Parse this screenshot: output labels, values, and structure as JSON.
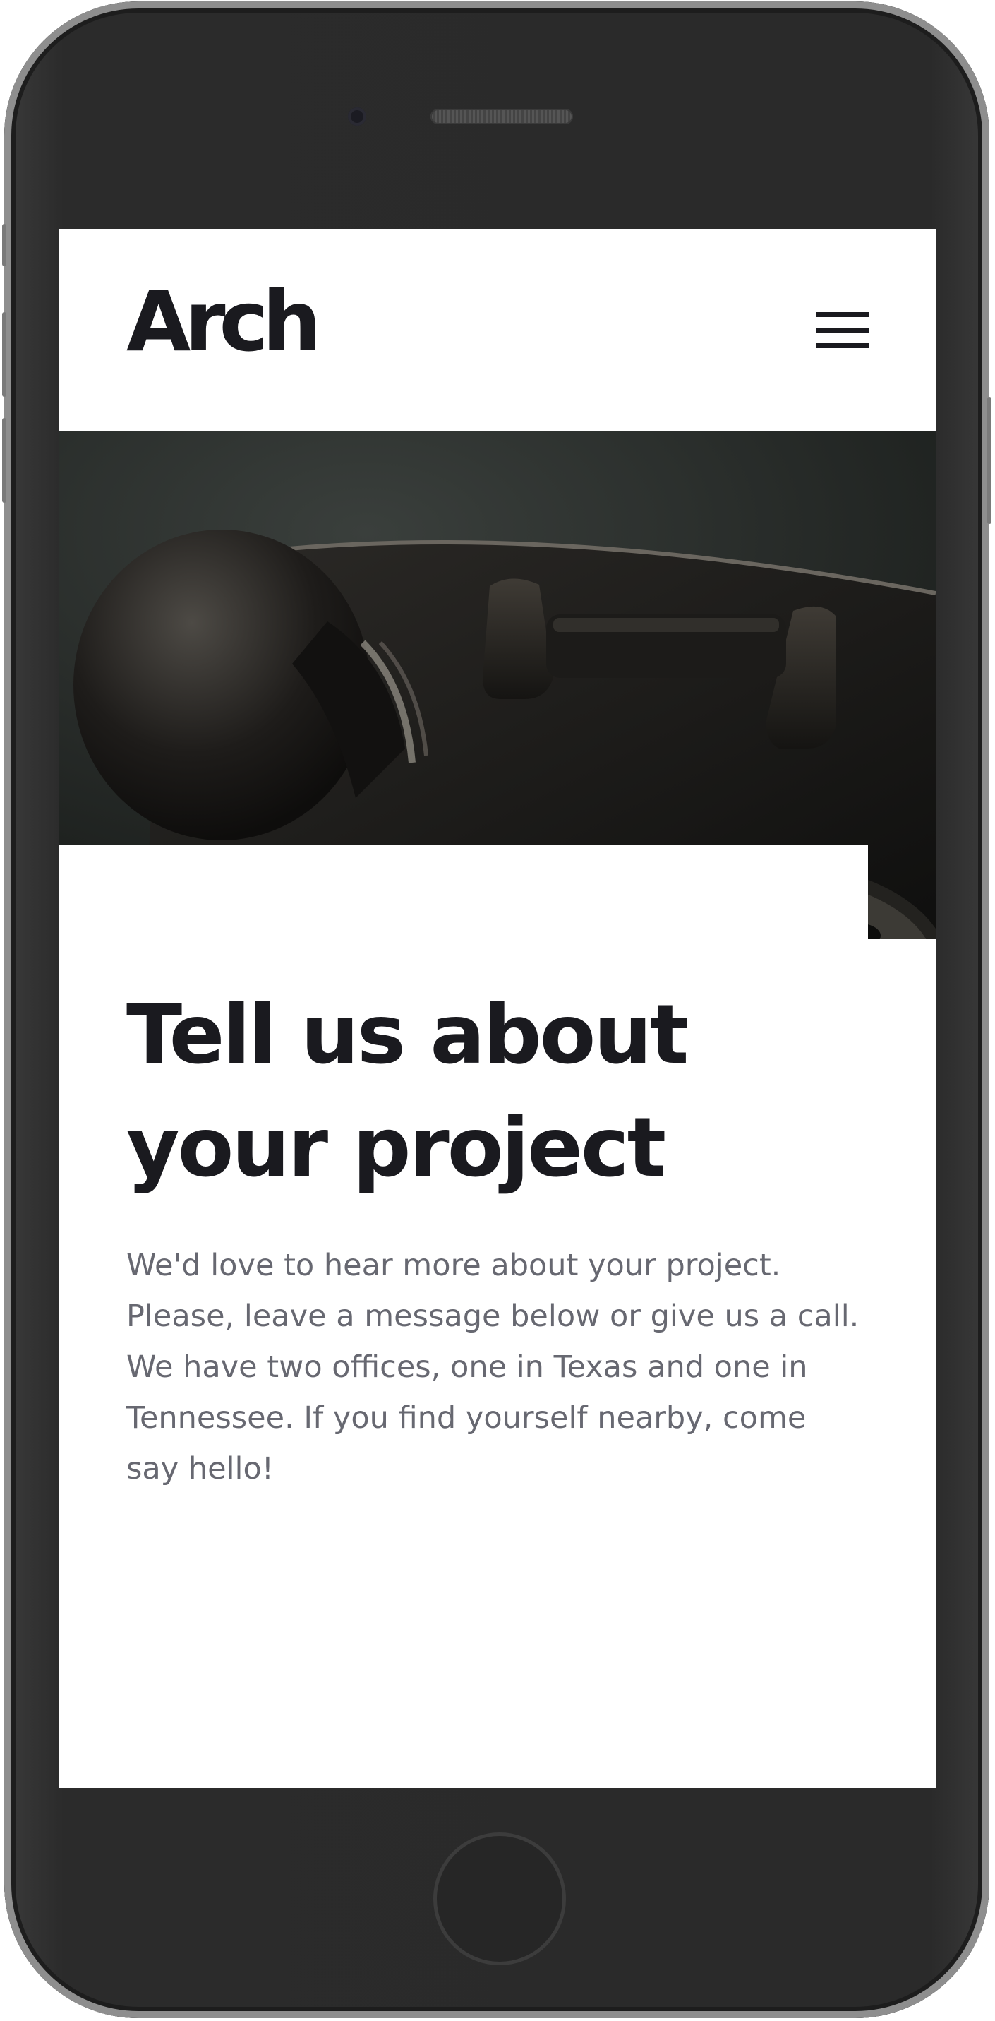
{
  "brand": {
    "logo": "Arch"
  },
  "nav": {
    "menu_icon": "hamburger-menu-icon"
  },
  "hero": {
    "image": "vintage-rotary-telephone-photo"
  },
  "contact": {
    "headline_line1": "Tell us about",
    "headline_line2": "your project",
    "body": "We'd love to hear more about your project. Please, leave a message below or give us a call. We have two offices, one in Texas and one in Tennessee. If you find yourself nearby, come say hello!"
  },
  "colors": {
    "text_dark": "#1a1a1f",
    "text_muted": "#676871",
    "divider": "#c9cbd6",
    "device_body": "#2a2a2a"
  }
}
